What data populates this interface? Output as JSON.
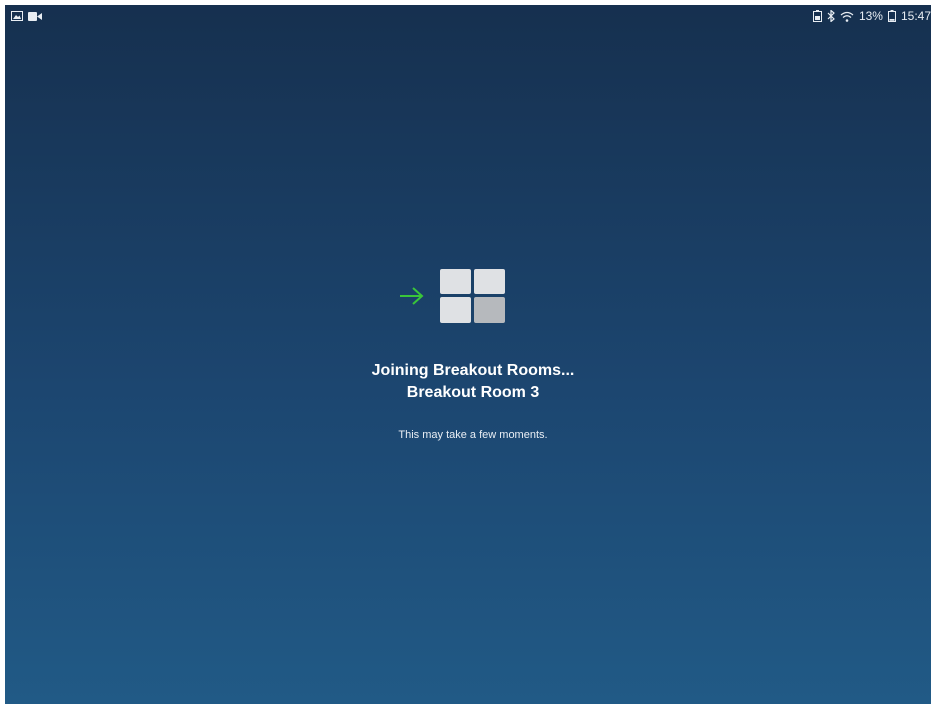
{
  "status_bar": {
    "left_icons": [
      "gallery-icon",
      "video-camera-icon"
    ],
    "battery_percent": "13%",
    "time": "15:47",
    "right_icons": [
      "battery-saver-icon",
      "bluetooth-icon",
      "wifi-icon",
      "battery-icon"
    ]
  },
  "joining": {
    "title": "Joining Breakout Rooms...",
    "room_name": "Breakout Room 3",
    "message": "This may take a few moments."
  },
  "colors": {
    "background_top": "#16304f",
    "background_bottom": "#215a86",
    "arrow": "#39c53a",
    "tile_light": "#dfe1e4",
    "tile_dark": "#b6b9bd"
  }
}
